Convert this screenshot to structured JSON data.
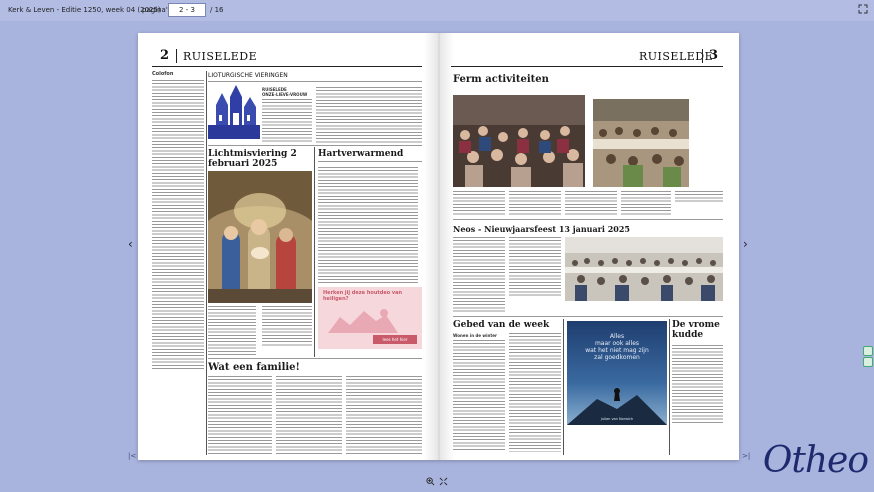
{
  "toolbar": {
    "title": "Kerk & Leven - Editie 1250, week 04 (2025)",
    "page_label": "pagina's:",
    "page_value": "2 - 3",
    "page_total": "/ 16"
  },
  "left_page": {
    "number": "2",
    "title": "RUISELEDE",
    "colofon_title": "Colofon",
    "liturgie_title": "LIOTURGISCHE VIERINGEN",
    "liturgie_sub1": "RUISELEDE",
    "liturgie_sub2": "ONZE-LIEVE-VROUW",
    "lichtmis_title": "Lichtmisviering 2 februari 2025",
    "hart_title": "Hartverwarmend",
    "banner_text": "Herken jij deze houtdeo van heiligen?",
    "banner_button": "lees het hier",
    "familie_title": "Wat een familie!"
  },
  "right_page": {
    "number": "3",
    "title": "RUISELEDE",
    "ferm_title": "Ferm activiteiten",
    "neos_title": "Neos - Nieuwjaarsfeest 13 januari 2025",
    "gebed_title": "Gebed van de week",
    "gebed_sub": "Wonen in de winter",
    "kudde_title": "De vrome kudde",
    "poster_line1": "Alles",
    "poster_line2": "maar ook alles",
    "poster_line3": "wat het niet mag zijn",
    "poster_line4": "zal goedkomen",
    "poster_footer": "Julian van Norwich"
  },
  "brand": {
    "logo": "Otheo"
  },
  "colors": {
    "background": "#a9b4de",
    "logo": "#1e2a6e",
    "banner": "#f6d8dc",
    "accent_red": "#c85a6a"
  }
}
